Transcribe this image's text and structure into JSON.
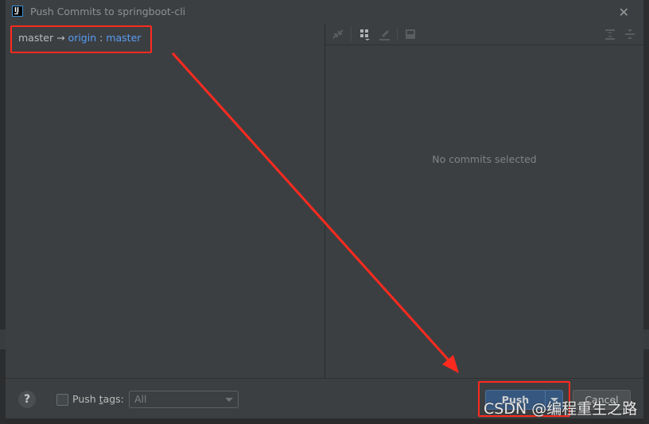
{
  "window": {
    "title": "Push Commits to springboot-cli",
    "app_icon": "intellij-idea-icon",
    "close_icon": "close-icon"
  },
  "left_pane": {
    "branch": {
      "local": "master",
      "arrow": "→",
      "remote": "origin",
      "separator": ":",
      "target": "master"
    }
  },
  "right_pane": {
    "toolbar": [
      {
        "name": "merge-icon"
      },
      {
        "name": "group-by-icon"
      },
      {
        "name": "edit-icon"
      },
      {
        "name": "preview-diff-icon"
      },
      {
        "name": "expand-all-icon"
      },
      {
        "name": "collapse-all-icon"
      }
    ],
    "empty_text": "No commits selected"
  },
  "footer": {
    "help_label": "?",
    "push_tags_label_pre": "Push ",
    "push_tags_label_mnemonic": "t",
    "push_tags_label_post": "ags:",
    "push_tags_checked": false,
    "tags_select_value": "All",
    "push_label": "Push",
    "cancel_label": "Cancel"
  },
  "annotations": {
    "highlight_color": "#ff2a1f",
    "watermark": "CSDN @编程重生之路"
  },
  "colors": {
    "dialog_bg": "#3c3f41",
    "link_blue": "#589df6",
    "primary_button": "#365880"
  }
}
